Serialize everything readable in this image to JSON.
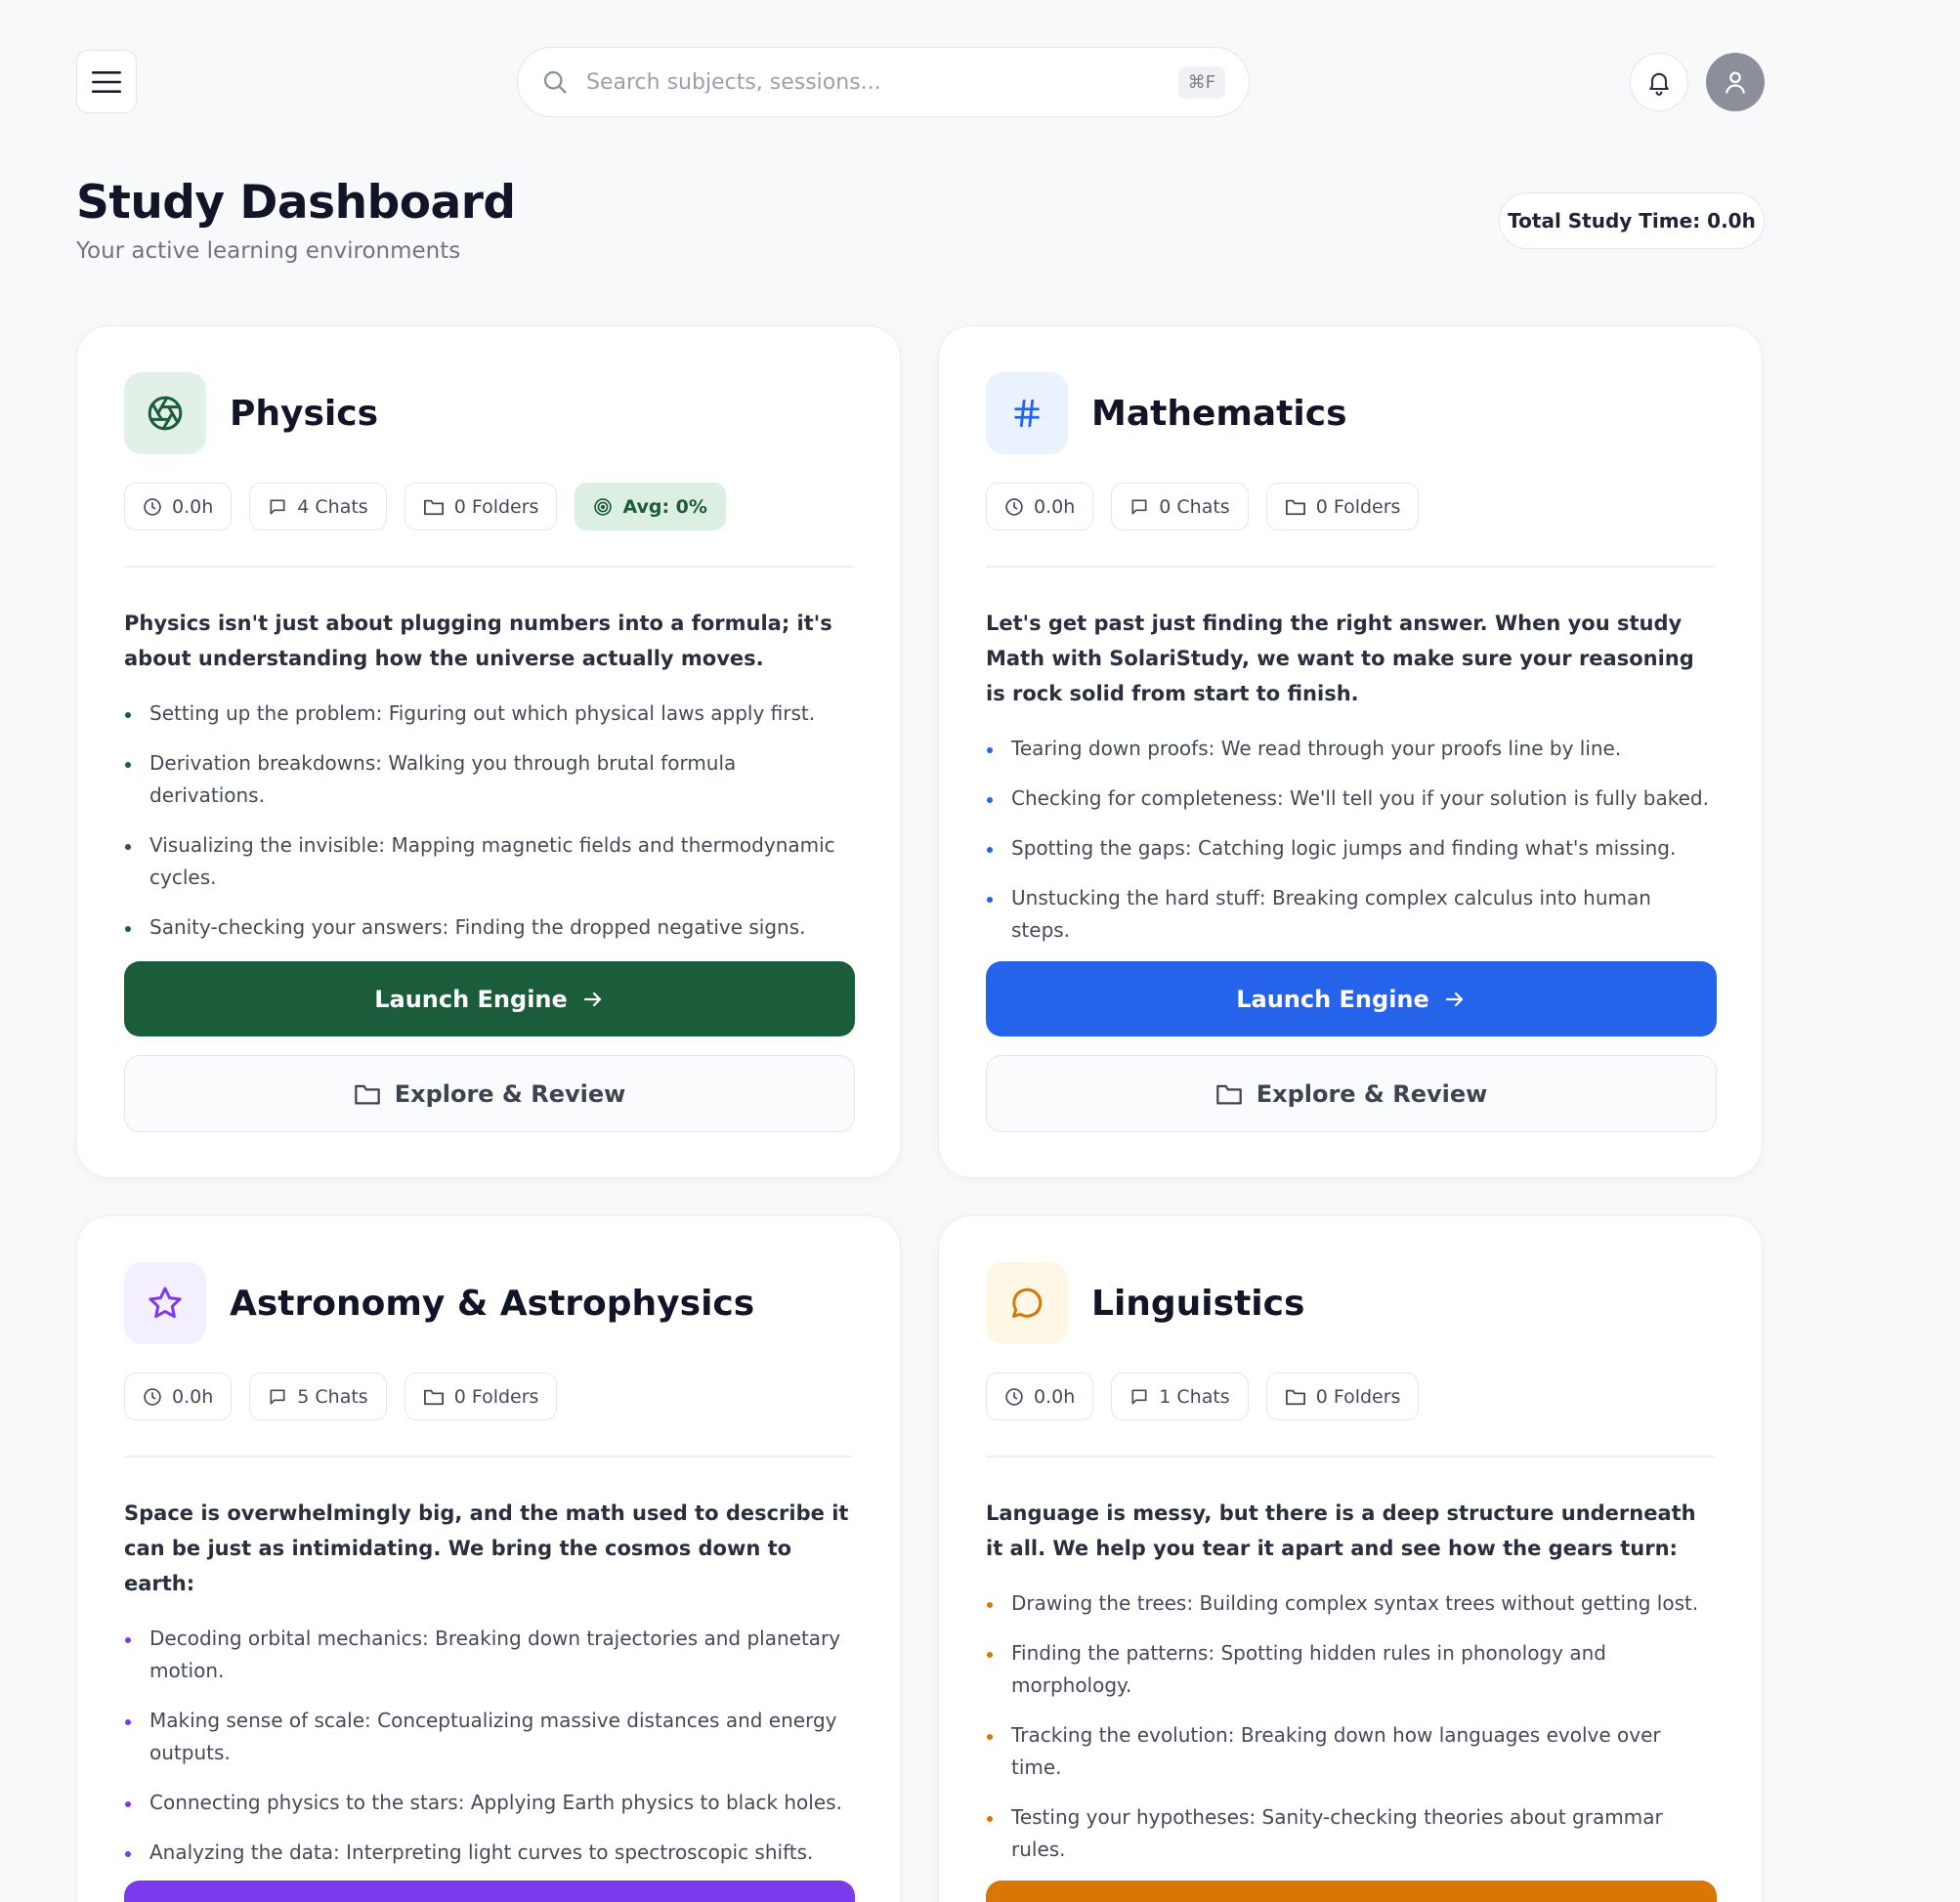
{
  "header": {
    "search_placeholder": "Search subjects, sessions...",
    "search_shortcut": "⌘F"
  },
  "page": {
    "title": "Study Dashboard",
    "subtitle": "Your active learning environments",
    "total_study_time": "Total Study Time: 0.0h"
  },
  "colors": {
    "physics": "#1b5d3a",
    "mathematics": "#2563eb",
    "astronomy": "#7c3aed",
    "linguistics": "#d97706"
  },
  "subjects": [
    {
      "name": "Physics",
      "icon": "aperture-icon",
      "hours": "0.0h",
      "chats": "4 Chats",
      "folders": "0 Folders",
      "avg": "Avg: 0%",
      "intro": "Physics isn't just about plugging numbers into a formula; it's about understanding how the universe actually moves.",
      "bullets": [
        "Setting up the problem: Figuring out which physical laws apply first.",
        "Derivation breakdowns: Walking you through brutal formula derivations.",
        "Visualizing the invisible: Mapping magnetic fields and thermodynamic cycles.",
        "Sanity-checking your answers: Finding the dropped negative signs."
      ],
      "launch_label": "Launch Engine",
      "explore_label": "Explore & Review"
    },
    {
      "name": "Mathematics",
      "icon": "hash-icon",
      "hours": "0.0h",
      "chats": "0 Chats",
      "folders": "0 Folders",
      "intro": "Let's get past just finding the right answer. When you study Math with SolariStudy, we want to make sure your reasoning is rock solid from start to finish.",
      "bullets": [
        "Tearing down proofs: We read through your proofs line by line.",
        "Checking for completeness: We'll tell you if your solution is fully baked.",
        "Spotting the gaps: Catching logic jumps and finding what's missing.",
        "Unstucking the hard stuff: Breaking complex calculus into human steps."
      ],
      "launch_label": "Launch Engine",
      "explore_label": "Explore & Review"
    },
    {
      "name": "Astronomy & Astrophysics",
      "icon": "star-icon",
      "hours": "0.0h",
      "chats": "5 Chats",
      "folders": "0 Folders",
      "intro": "Space is overwhelmingly big, and the math used to describe it can be just as intimidating. We bring the cosmos down to earth:",
      "bullets": [
        "Decoding orbital mechanics: Breaking down trajectories and planetary motion.",
        "Making sense of scale: Conceptualizing massive distances and energy outputs.",
        "Connecting physics to the stars: Applying Earth physics to black holes.",
        "Analyzing the data: Interpreting light curves to spectroscopic shifts."
      ]
    },
    {
      "name": "Linguistics",
      "icon": "speech-bubble-icon",
      "hours": "0.0h",
      "chats": "1 Chats",
      "folders": "0 Folders",
      "intro": "Language is messy, but there is a deep structure underneath it all. We help you tear it apart and see how the gears turn:",
      "bullets": [
        "Drawing the trees: Building complex syntax trees without getting lost.",
        "Finding the patterns: Spotting hidden rules in phonology and morphology.",
        "Tracking the evolution: Breaking down how languages evolve over time.",
        "Testing your hypotheses: Sanity-checking theories about grammar rules."
      ]
    }
  ]
}
